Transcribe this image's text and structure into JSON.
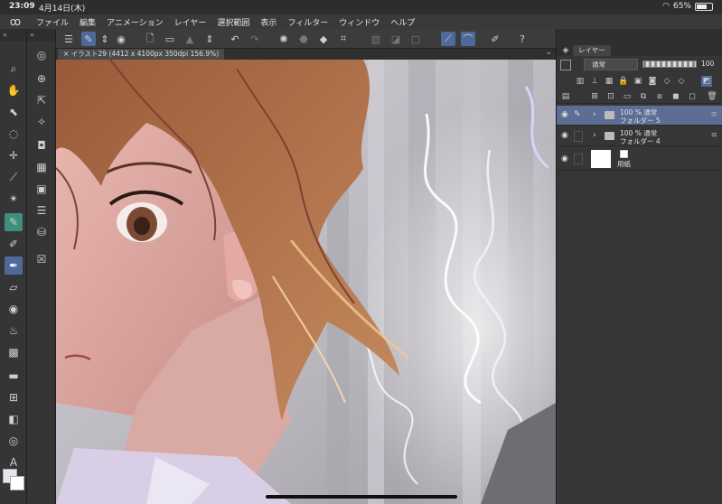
{
  "status_bar": {
    "time": "23:09",
    "date": "4月14日(木)",
    "battery": "65%"
  },
  "menu": [
    "ファイル",
    "編集",
    "アニメーション",
    "レイヤー",
    "選択範囲",
    "表示",
    "フィルター",
    "ウィンドウ",
    "ヘルプ"
  ],
  "document_tab": {
    "label": "× イラスト29 (4412 x 4100px 350dpi 156.9%)"
  },
  "layer_panel": {
    "tab_label": "レイヤー",
    "blend_mode": "通常",
    "opacity": "100",
    "layers": [
      {
        "opacity_mode": "100 % 通常",
        "name": "フォルダー 5",
        "selected": true
      },
      {
        "opacity_mode": "100 % 通常",
        "name": "フォルダー 4",
        "selected": false
      },
      {
        "name": "用紙",
        "selected": false
      }
    ]
  },
  "colors": {
    "accent": "#4f6a9a",
    "selected_layer": "#5d6e95",
    "panel_bg": "#363636"
  }
}
